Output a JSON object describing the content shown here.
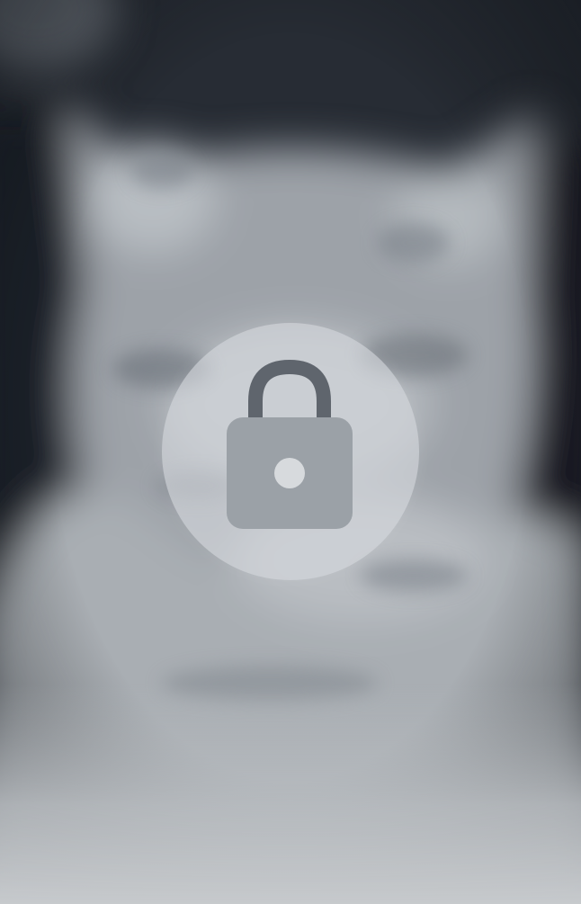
{
  "screen": {
    "type": "locked-media-preview"
  },
  "background": {
    "subject": "cat-photo-blurred",
    "colors": {
      "dark": "#1f242c",
      "mid": "#6f757d",
      "light": "#c3c7cb"
    }
  },
  "lock_overlay": {
    "icon": "lock-icon",
    "circle_color": "#d6dade",
    "icon_color": "#9aa0a6",
    "shackle_color": "#5d636b"
  }
}
